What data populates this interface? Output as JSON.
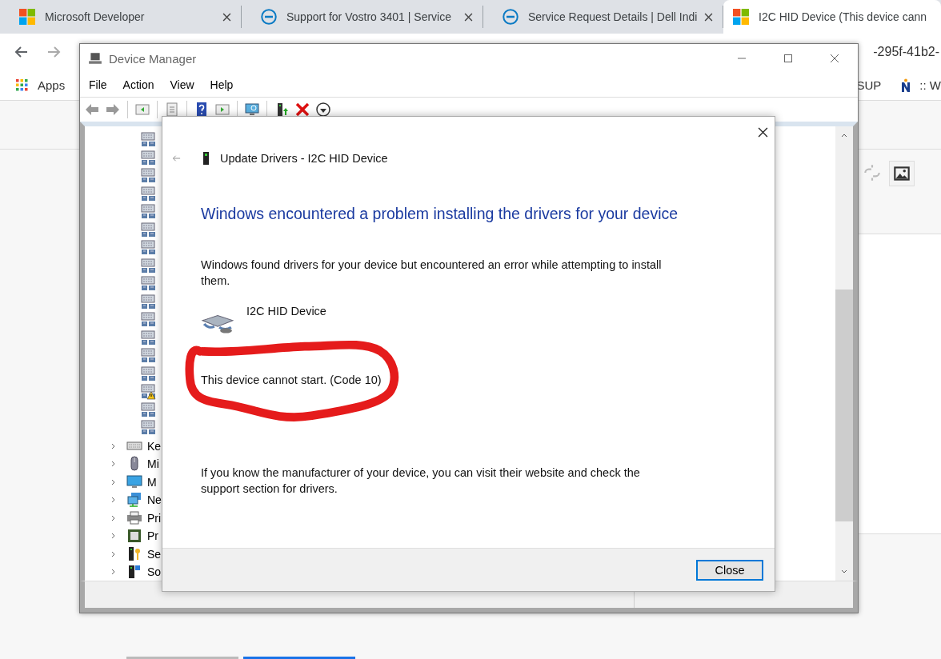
{
  "browser": {
    "tabs": [
      {
        "kind": "squares",
        "title": "Microsoft Developer",
        "selected": false
      },
      {
        "kind": "circle",
        "title": "Support for Vostro 3401 | Service",
        "selected": false
      },
      {
        "kind": "circle",
        "title": "Service Request Details | Dell Indi",
        "selected": false
      },
      {
        "kind": "squares",
        "title": "I2C HID Device (This device cann",
        "selected": true
      }
    ],
    "url": "-295f-41b2-",
    "bookmarks_left": "Apps",
    "bookmarks_right": [
      {
        "kind": "text",
        "label": "SUP"
      },
      {
        "kind": "logo",
        "label": ":: W"
      }
    ]
  },
  "window": {
    "title": "Device Manager",
    "menu": [
      "File",
      "Action",
      "View",
      "Help"
    ],
    "tree": [
      {
        "kind": "device",
        "warning": false
      },
      {
        "kind": "device",
        "warning": false
      },
      {
        "kind": "device",
        "warning": false
      },
      {
        "kind": "device",
        "warning": false
      },
      {
        "kind": "device",
        "warning": false
      },
      {
        "kind": "device",
        "warning": false
      },
      {
        "kind": "device",
        "warning": false
      },
      {
        "kind": "device",
        "warning": false
      },
      {
        "kind": "device",
        "warning": false
      },
      {
        "kind": "device",
        "warning": false
      },
      {
        "kind": "device",
        "warning": false
      },
      {
        "kind": "device",
        "warning": false
      },
      {
        "kind": "device",
        "warning": false
      },
      {
        "kind": "device",
        "warning": false
      },
      {
        "kind": "device",
        "warning": true
      },
      {
        "kind": "device",
        "warning": false
      },
      {
        "kind": "device",
        "warning": false
      },
      {
        "kind": "keyboard",
        "label": "Ke",
        "expanded": false
      },
      {
        "kind": "mouse",
        "label": "Mi",
        "expanded": false
      },
      {
        "kind": "monitor",
        "label": "M",
        "expanded": false
      },
      {
        "kind": "network",
        "label": "Ne",
        "expanded": false
      },
      {
        "kind": "printer",
        "label": "Pri",
        "expanded": false
      },
      {
        "kind": "processor",
        "label": "Pr",
        "expanded": false
      },
      {
        "kind": "security",
        "label": "Se",
        "expanded": false
      },
      {
        "kind": "software",
        "label": "So",
        "expanded": false
      }
    ]
  },
  "dialog": {
    "title": "Update Drivers - I2C HID Device",
    "heading": "Windows encountered a problem installing the drivers for your device",
    "message": "Windows found drivers for your device but encountered an error while attempting to install them.",
    "device_name": "I2C HID Device",
    "error": "This device cannot start. (Code 10)",
    "hint": "If you know the manufacturer of your device, you can visit their website and check the support section for drivers.",
    "buttons": [
      "Close"
    ]
  }
}
